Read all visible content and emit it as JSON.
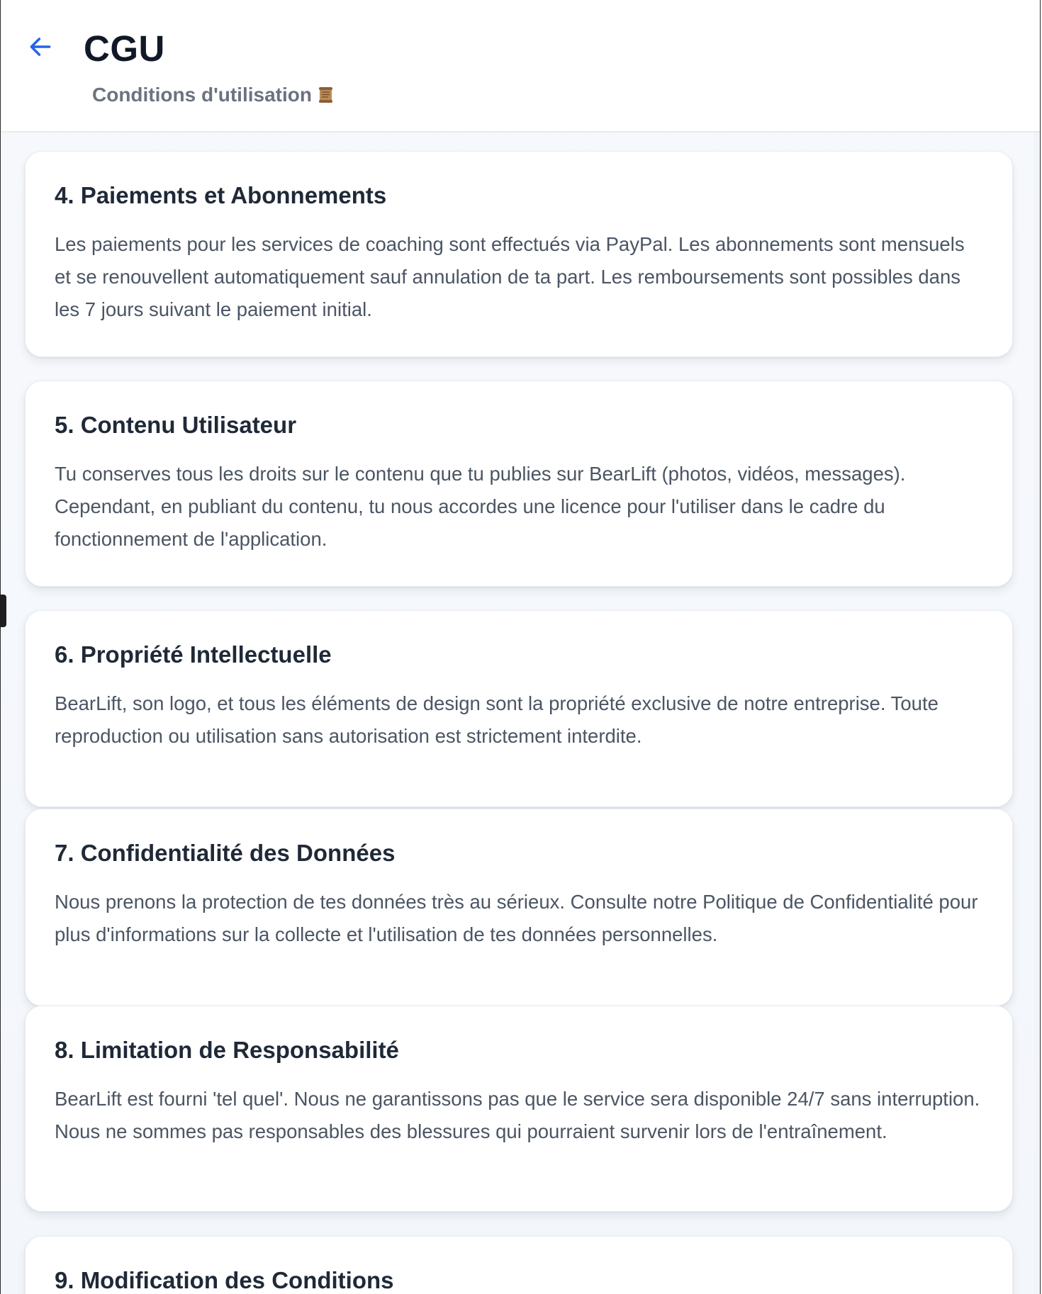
{
  "header": {
    "back_icon": "arrow-left-icon",
    "title": "CGU",
    "subtitle": "Conditions d'utilisation",
    "subtitle_icon": "scroll-emoji-icon",
    "accent_color": "#2563eb"
  },
  "sections": [
    {
      "title": "4. Paiements et Abonnements",
      "body": "Les paiements pour les services de coaching sont effectués via PayPal. Les abonnements sont mensuels et se renouvellent automatiquement sauf annulation de ta part. Les remboursements sont possibles dans les 7 jours suivant le paiement initial."
    },
    {
      "title": "5. Contenu Utilisateur",
      "body": "Tu conserves tous les droits sur le contenu que tu publies sur BearLift (photos, vidéos, messages). Cependant, en publiant du contenu, tu nous accordes une licence pour l'utiliser dans le cadre du fonctionnement de l'application."
    },
    {
      "title": "6. Propriété Intellectuelle",
      "body": "BearLift, son logo, et tous les éléments de design sont la propriété exclusive de notre entreprise. Toute reproduction ou utilisation sans autorisation est strictement interdite."
    },
    {
      "title": "7. Confidentialité des Données",
      "body": "Nous prenons la protection de tes données très au sérieux. Consulte notre Politique de Confidentialité pour plus d'informations sur la collecte et l'utilisation de tes données personnelles."
    },
    {
      "title": "8. Limitation de Responsabilité",
      "body": "BearLift est fourni 'tel quel'. Nous ne garantissons pas que le service sera disponible 24/7 sans interruption. Nous ne sommes pas responsables des blessures qui pourraient survenir lors de l'entraînement."
    },
    {
      "title": "9. Modification des Conditions",
      "body": ""
    }
  ]
}
